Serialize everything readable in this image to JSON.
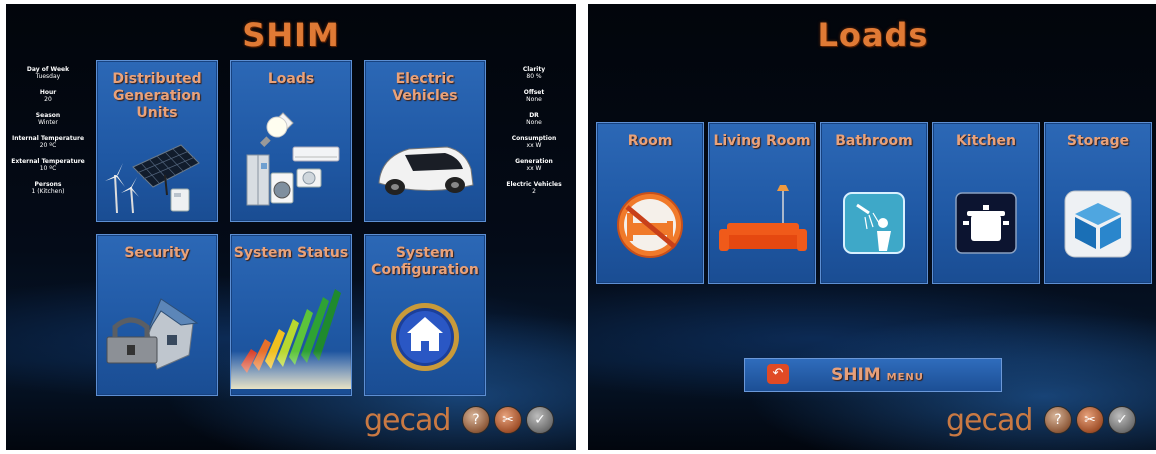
{
  "left": {
    "title": "SHIM",
    "info_left": [
      {
        "label": "Day of Week",
        "value": "Tuesday"
      },
      {
        "label": "Hour",
        "value": "20"
      },
      {
        "label": "Season",
        "value": "Winter"
      },
      {
        "label": "Internal Temperature",
        "value": "20 ºC"
      },
      {
        "label": "External Temperature",
        "value": "10 ºC"
      },
      {
        "label": "Persons",
        "value": "1 (Kitchen)"
      }
    ],
    "info_right": [
      {
        "label": "Clarity",
        "value": "80 %"
      },
      {
        "label": "Offset",
        "value": "None"
      },
      {
        "label": "DR",
        "value": "None"
      },
      {
        "label": "Consumption",
        "value": "xx W"
      },
      {
        "label": "Generation",
        "value": "xx W"
      },
      {
        "label": "Electric Vehicles",
        "value": "2"
      }
    ],
    "tiles": [
      {
        "label": "Distributed Generation Units",
        "icon": "solar-wind-generation-icon"
      },
      {
        "label": "Loads",
        "icon": "appliances-icon"
      },
      {
        "label": "Electric Vehicles",
        "icon": "electric-car-icon"
      },
      {
        "label": "Security",
        "icon": "house-lock-icon"
      },
      {
        "label": "System Status",
        "icon": "bar-graph-icon"
      },
      {
        "label": "System Configuration",
        "icon": "home-config-icon"
      }
    ],
    "brand": "gecad"
  },
  "right": {
    "title": "Loads",
    "tiles": [
      {
        "label": "Room",
        "icon": "bed-icon"
      },
      {
        "label": "Living Room",
        "icon": "sofa-icon"
      },
      {
        "label": "Bathroom",
        "icon": "shower-icon"
      },
      {
        "label": "Kitchen",
        "icon": "cooking-pot-icon"
      },
      {
        "label": "Storage",
        "icon": "box-icon"
      }
    ],
    "menu_button": {
      "main": "SHIM",
      "sub": "MENU"
    },
    "brand": "gecad"
  },
  "footer_buttons": [
    "help-button",
    "tools-button",
    "back-button"
  ],
  "colors": {
    "accent": "#e07a35",
    "tile": "#2563ad",
    "background": "#03070f"
  }
}
